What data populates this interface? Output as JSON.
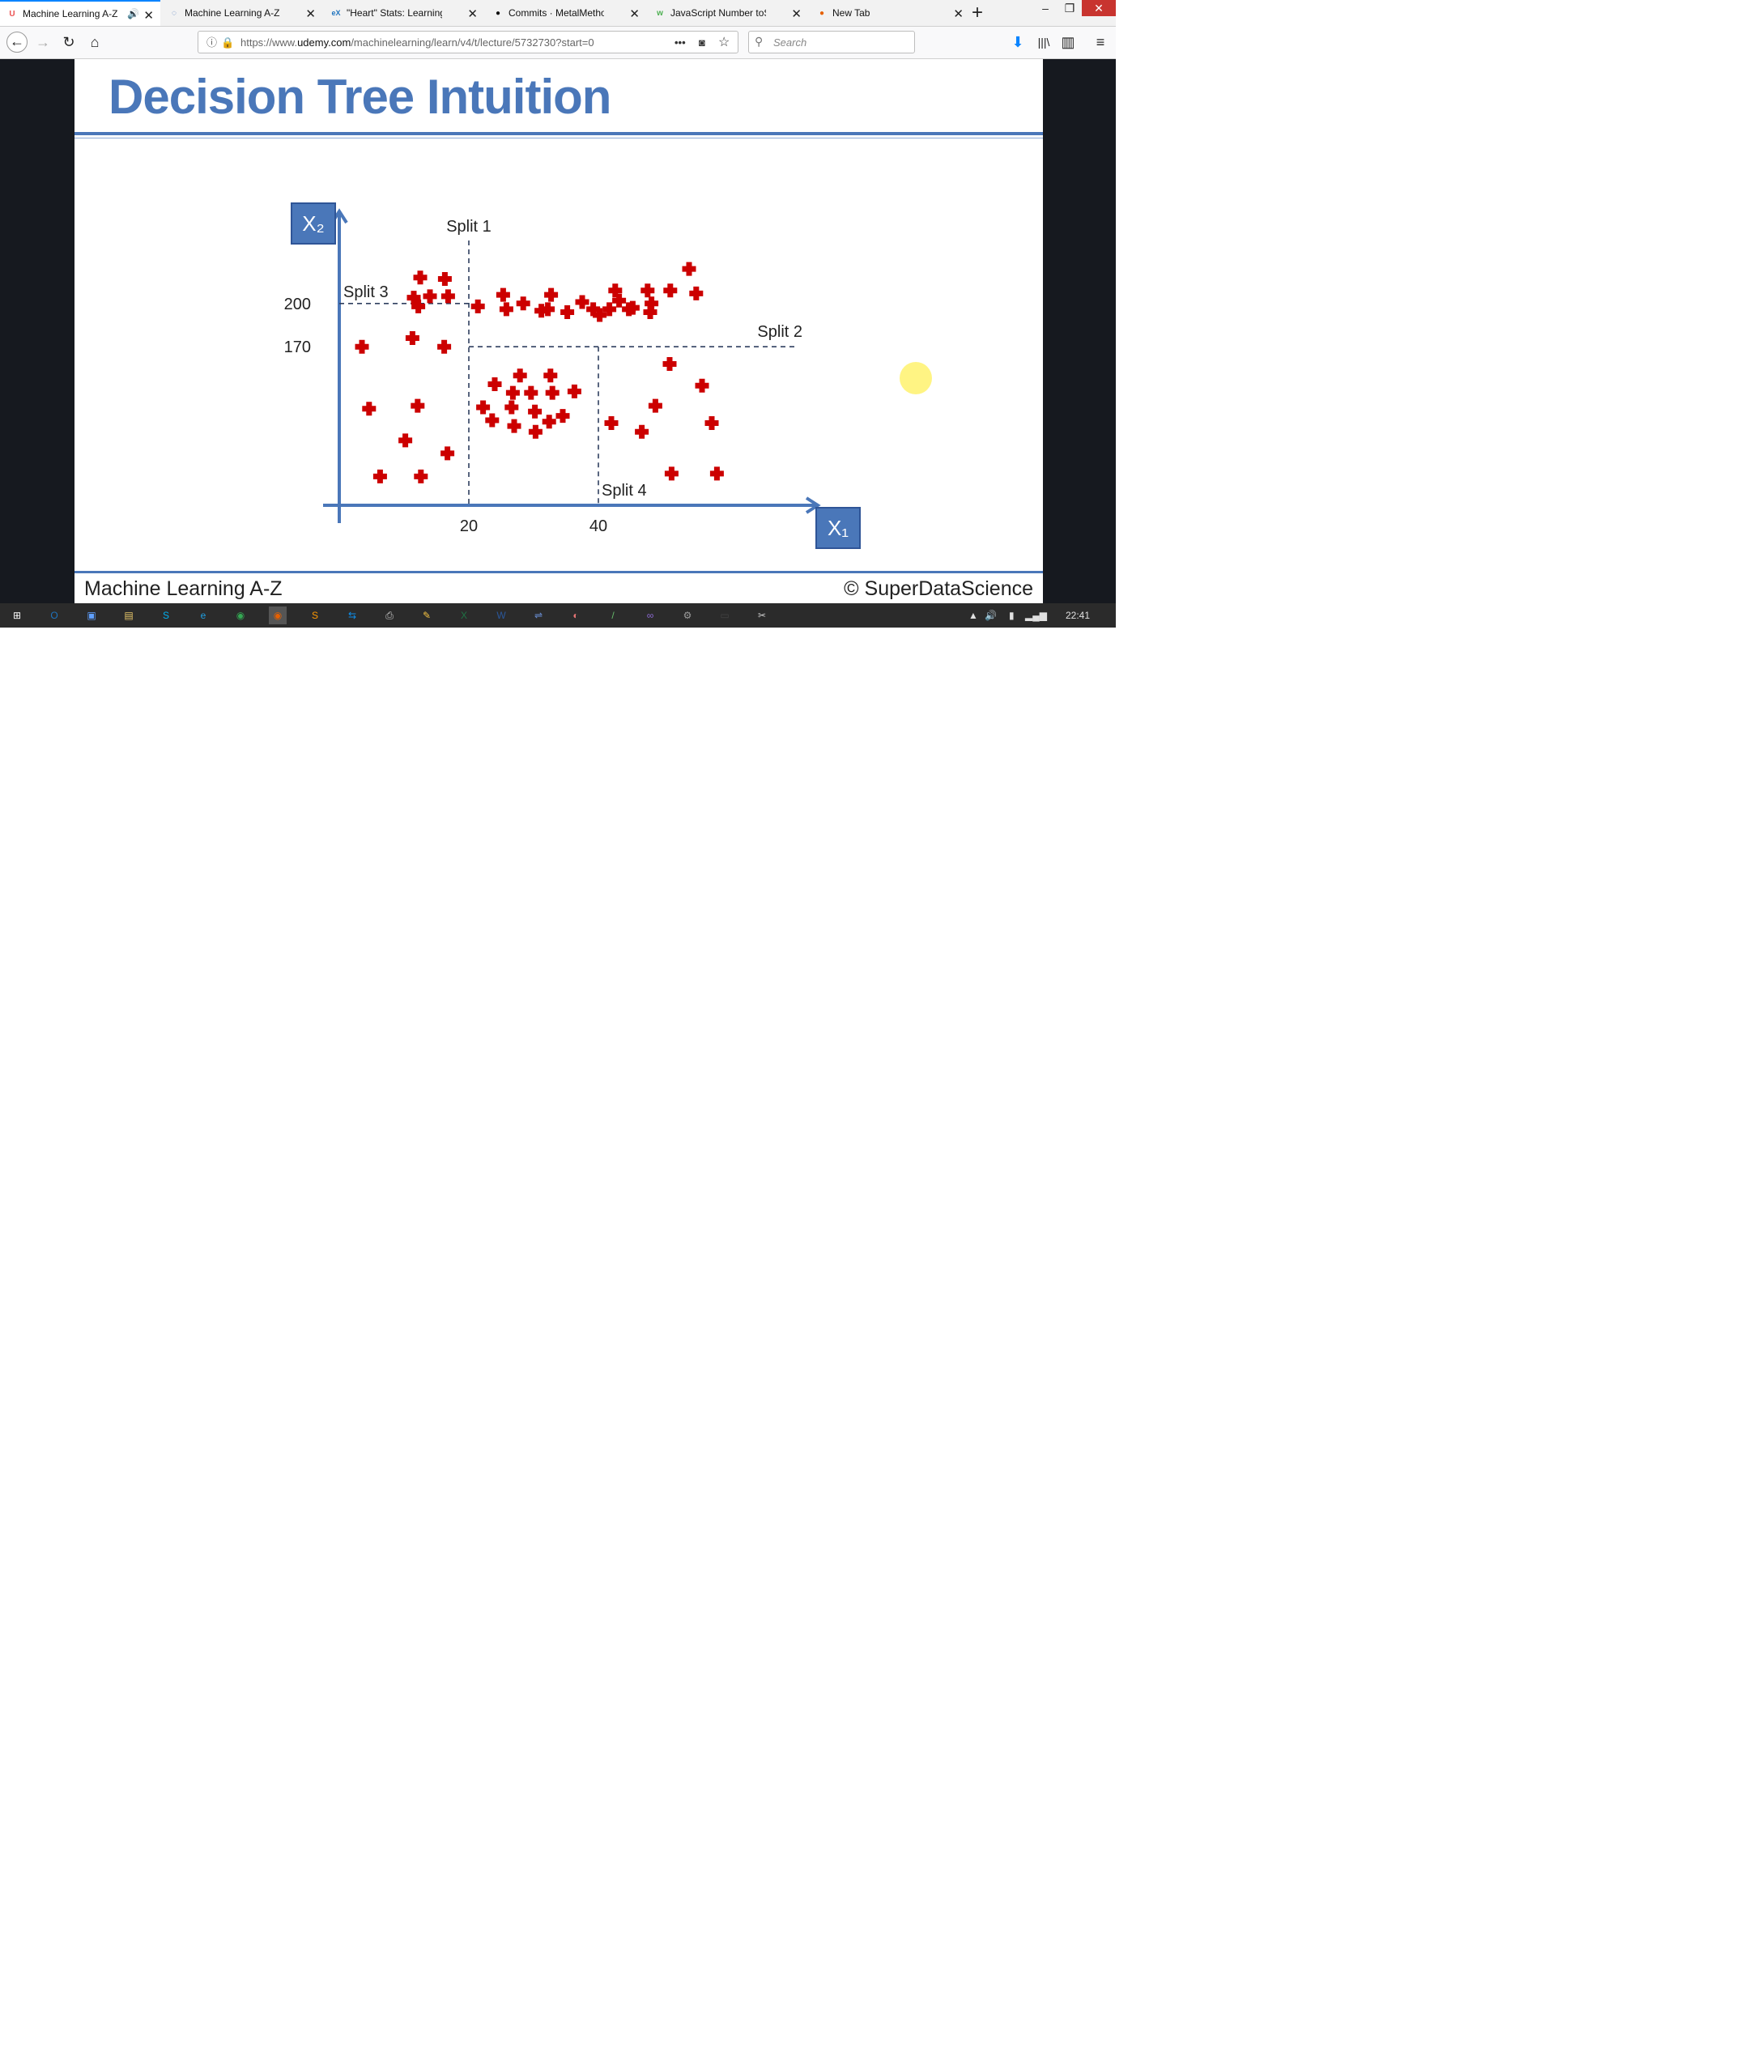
{
  "browser": {
    "tabs": [
      {
        "title": "Machine Learning A-Z",
        "icon": "udemy-icon",
        "active": true
      },
      {
        "title": "Machine Learning A-Z™: H",
        "icon": "speech-bubble-icon",
        "active": false
      },
      {
        "title": "\"Heart\" Stats: Learning to",
        "icon": "edx-icon",
        "active": false
      },
      {
        "title": "Commits · MetalMethod/N",
        "icon": "github-icon",
        "active": false
      },
      {
        "title": "JavaScript Number toString",
        "icon": "w3schools-icon",
        "active": false
      },
      {
        "title": "New Tab",
        "icon": "firefox-icon",
        "active": false
      }
    ],
    "new_tab_label": "+",
    "window_controls": {
      "minimize": "–",
      "restore": "❐",
      "close": "✕"
    },
    "url_prefix": "https://www.",
    "url_domain": "udemy.com",
    "url_path": "/machinelearning/learn/v4/t/lecture/5732730?start=0",
    "page_actions": "•••",
    "search_placeholder": "Search"
  },
  "slide": {
    "title": "Decision Tree Intuition",
    "footer_left": "Machine Learning A-Z",
    "footer_right": "© SuperDataScience"
  },
  "chart_data": {
    "type": "scatter",
    "title": "",
    "xlabel": "X₁",
    "ylabel": "X₂",
    "x_ticks": [
      20,
      40
    ],
    "y_ticks": [
      170,
      200
    ],
    "xlim": [
      0,
      70
    ],
    "ylim": [
      60,
      240
    ],
    "marker_color": "#cc0000",
    "axis_color": "#4a77b9",
    "splits": [
      {
        "label": "Split 1",
        "orientation": "vertical",
        "at": 20
      },
      {
        "label": "Split 2",
        "orientation": "horizontal",
        "at": 170,
        "x_from": 20
      },
      {
        "label": "Split 3",
        "orientation": "horizontal",
        "at": 200,
        "x_to": 20
      },
      {
        "label": "Split 4",
        "orientation": "vertical",
        "at": 40,
        "y_to": 170
      }
    ],
    "points": [
      [
        12.5,
        218
      ],
      [
        11.5,
        204
      ],
      [
        14,
        205
      ],
      [
        16.3,
        217
      ],
      [
        16.8,
        205
      ],
      [
        12.2,
        198
      ],
      [
        3.5,
        170
      ],
      [
        11.3,
        176
      ],
      [
        16.2,
        170
      ],
      [
        4.6,
        127
      ],
      [
        12.1,
        129
      ],
      [
        10.2,
        105
      ],
      [
        6.3,
        80
      ],
      [
        12.6,
        80
      ],
      [
        16.7,
        96
      ],
      [
        21.4,
        198
      ],
      [
        25.3,
        206
      ],
      [
        25.8,
        196
      ],
      [
        28.4,
        200
      ],
      [
        31.2,
        195
      ],
      [
        32.2,
        196
      ],
      [
        32.7,
        206
      ],
      [
        35.2,
        194
      ],
      [
        37.5,
        201
      ],
      [
        39.2,
        196
      ],
      [
        40.2,
        192
      ],
      [
        41.7,
        196
      ],
      [
        42.6,
        209
      ],
      [
        43.2,
        202
      ],
      [
        44.7,
        196
      ],
      [
        45.3,
        197
      ],
      [
        47.6,
        209
      ],
      [
        48.2,
        200
      ],
      [
        48.0,
        194
      ],
      [
        51.1,
        209
      ],
      [
        54.0,
        224
      ],
      [
        55.1,
        207
      ],
      [
        22.2,
        128
      ],
      [
        23.6,
        119
      ],
      [
        24.0,
        144
      ],
      [
        26.8,
        138
      ],
      [
        26.6,
        128
      ],
      [
        27.0,
        115
      ],
      [
        27.9,
        150
      ],
      [
        29.6,
        138
      ],
      [
        30.2,
        125
      ],
      [
        30.3,
        111
      ],
      [
        32.6,
        150
      ],
      [
        32.9,
        138
      ],
      [
        32.4,
        118
      ],
      [
        34.5,
        122
      ],
      [
        36.3,
        139
      ],
      [
        42.0,
        117
      ],
      [
        46.7,
        111
      ],
      [
        48.8,
        129
      ],
      [
        51.3,
        82
      ],
      [
        51.0,
        158
      ],
      [
        56.0,
        143
      ],
      [
        57.5,
        117
      ],
      [
        58.3,
        82
      ]
    ]
  },
  "taskbar": {
    "clock": "22:41",
    "apps": [
      "windows-start-icon",
      "outlook-icon",
      "network-icon",
      "file-explorer-icon",
      "skype-icon",
      "internet-explorer-icon",
      "chrome-icon",
      "firefox-icon",
      "sublime-icon",
      "teamviewer-icon",
      "printer-icon",
      "paint-icon",
      "excel-icon",
      "word-icon",
      "remote-icon",
      "color-picker-icon",
      "pen-icon",
      "visual-studio-icon",
      "settings-icon",
      "terminal-icon",
      "snipping-icon"
    ]
  }
}
